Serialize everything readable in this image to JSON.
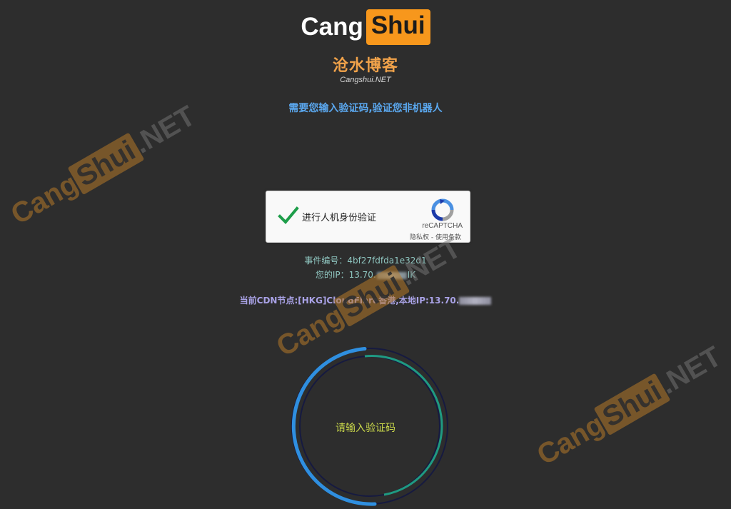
{
  "logo": {
    "left": "Cang",
    "right": "Shui",
    "cn": "沧水博客",
    "en": "Cangshui.NET"
  },
  "notice": "需要您输入验证码,验证您非机器人",
  "recaptcha": {
    "label": "进行人机身份验证",
    "brand": "reCAPTCHA",
    "terms": "隐私权 - 使用条款"
  },
  "event": "事件编号：4bf27fdfda1e32d1",
  "ip": {
    "prefix": "您的IP：13.70.",
    "suffix": "IK"
  },
  "cdn": {
    "text": "当前CDN节点:[HKG]CloudFlare香港,本地IP:13.70."
  },
  "ring": {
    "text": "请输入验证码",
    "colors": {
      "outer": "#2f8fe0",
      "inner": "#1f9a82",
      "track": "#161a40"
    }
  },
  "watermark": {
    "left": "Cang",
    "right": "Shui",
    "suffix": ".NET"
  }
}
